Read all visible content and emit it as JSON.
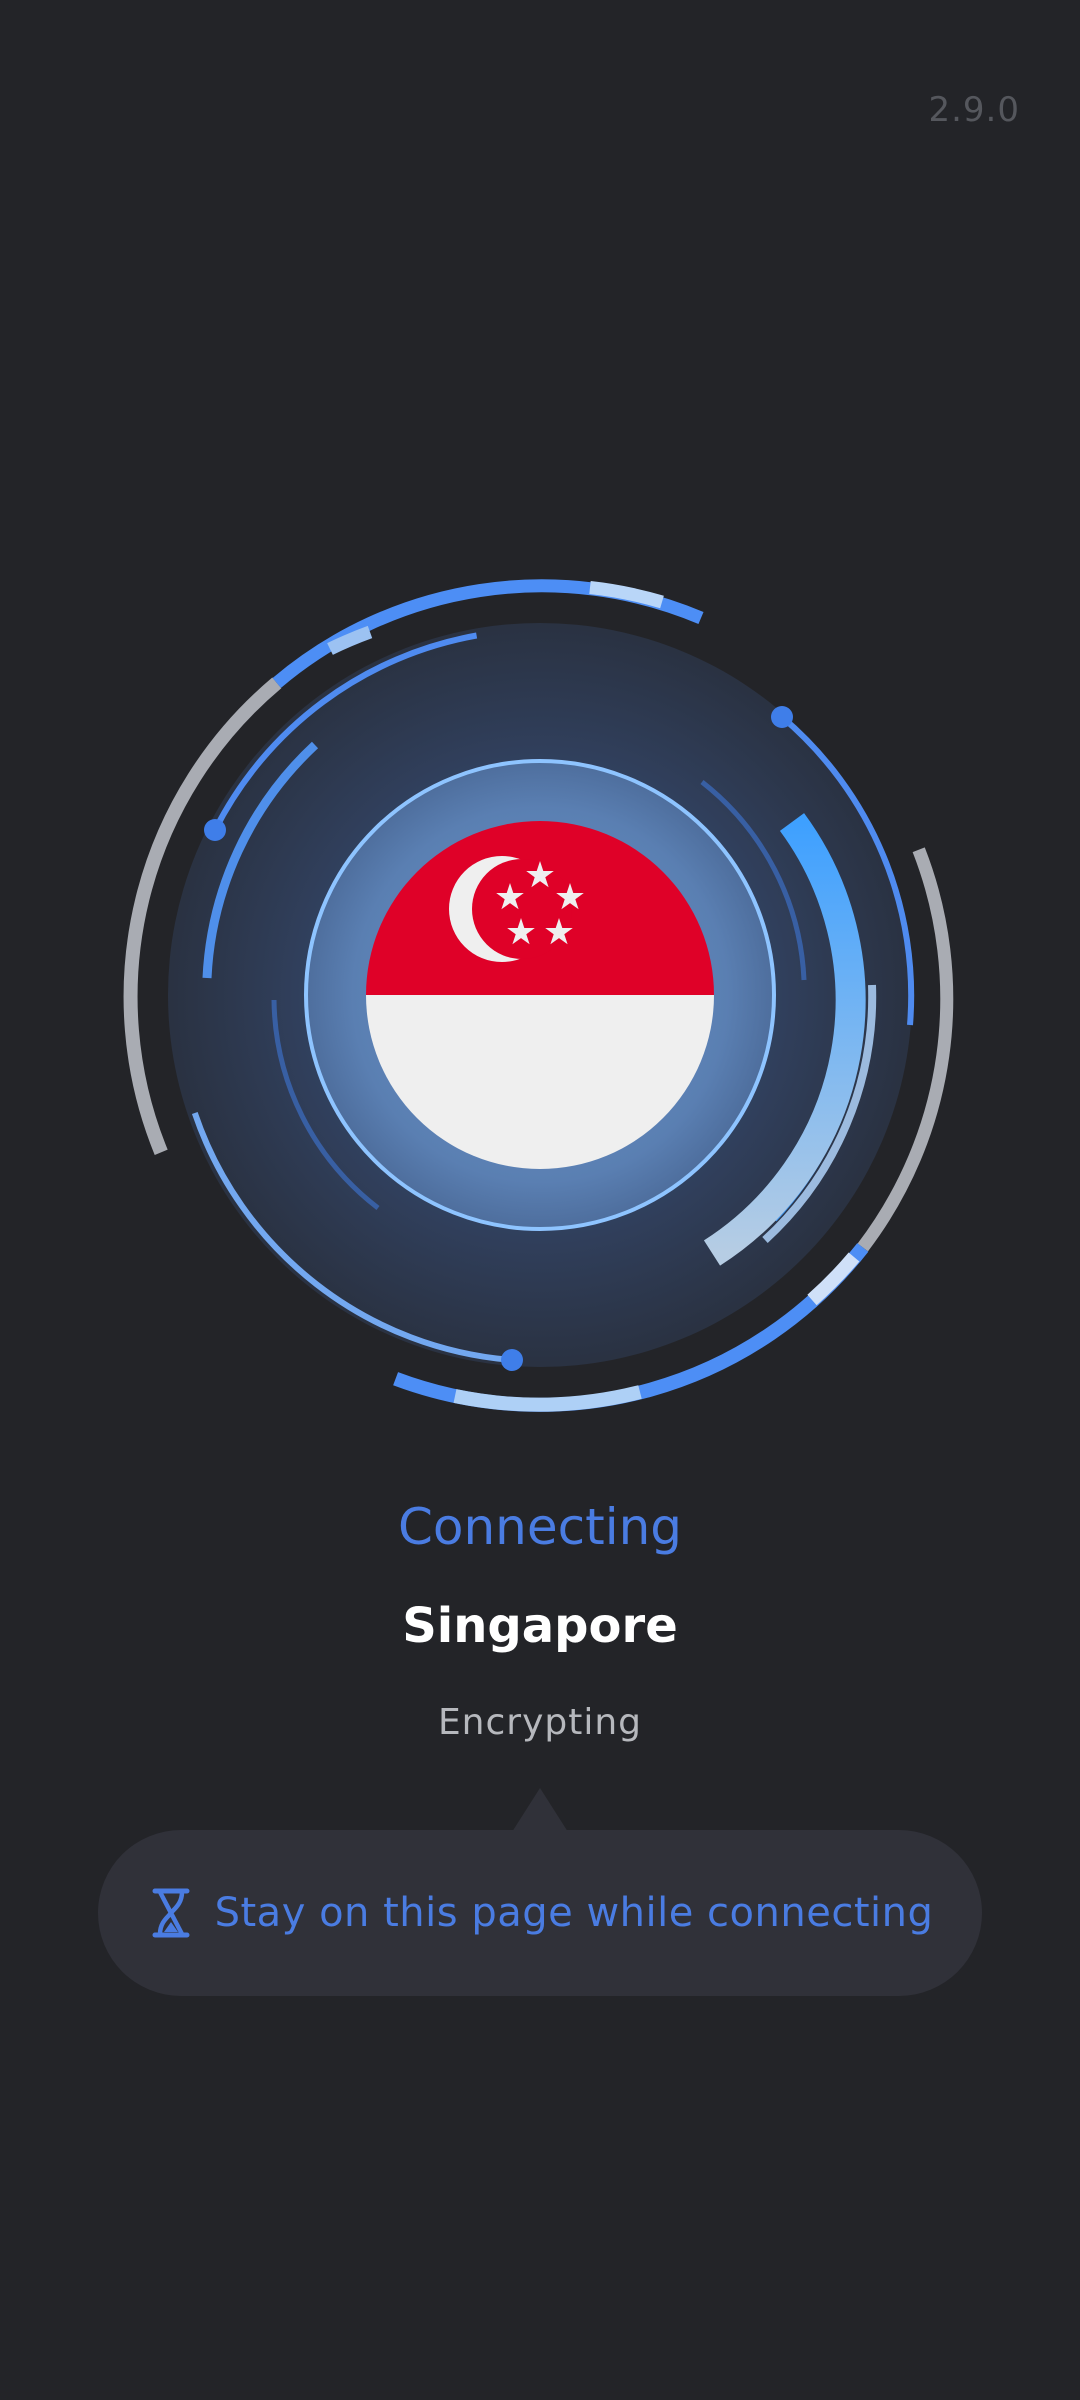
{
  "app": {
    "version": "2.9.0"
  },
  "connection": {
    "status": "Connecting",
    "location": "Singapore",
    "sub_status": "Encrypting",
    "flag_icon": "singapore-flag-icon"
  },
  "notice": {
    "icon": "hourglass-icon",
    "text": "Stay on this page while connecting"
  },
  "colors": {
    "background": "#232428",
    "accent": "#4a7ce2",
    "flag_red": "#df0128",
    "flag_white": "#efefef"
  }
}
